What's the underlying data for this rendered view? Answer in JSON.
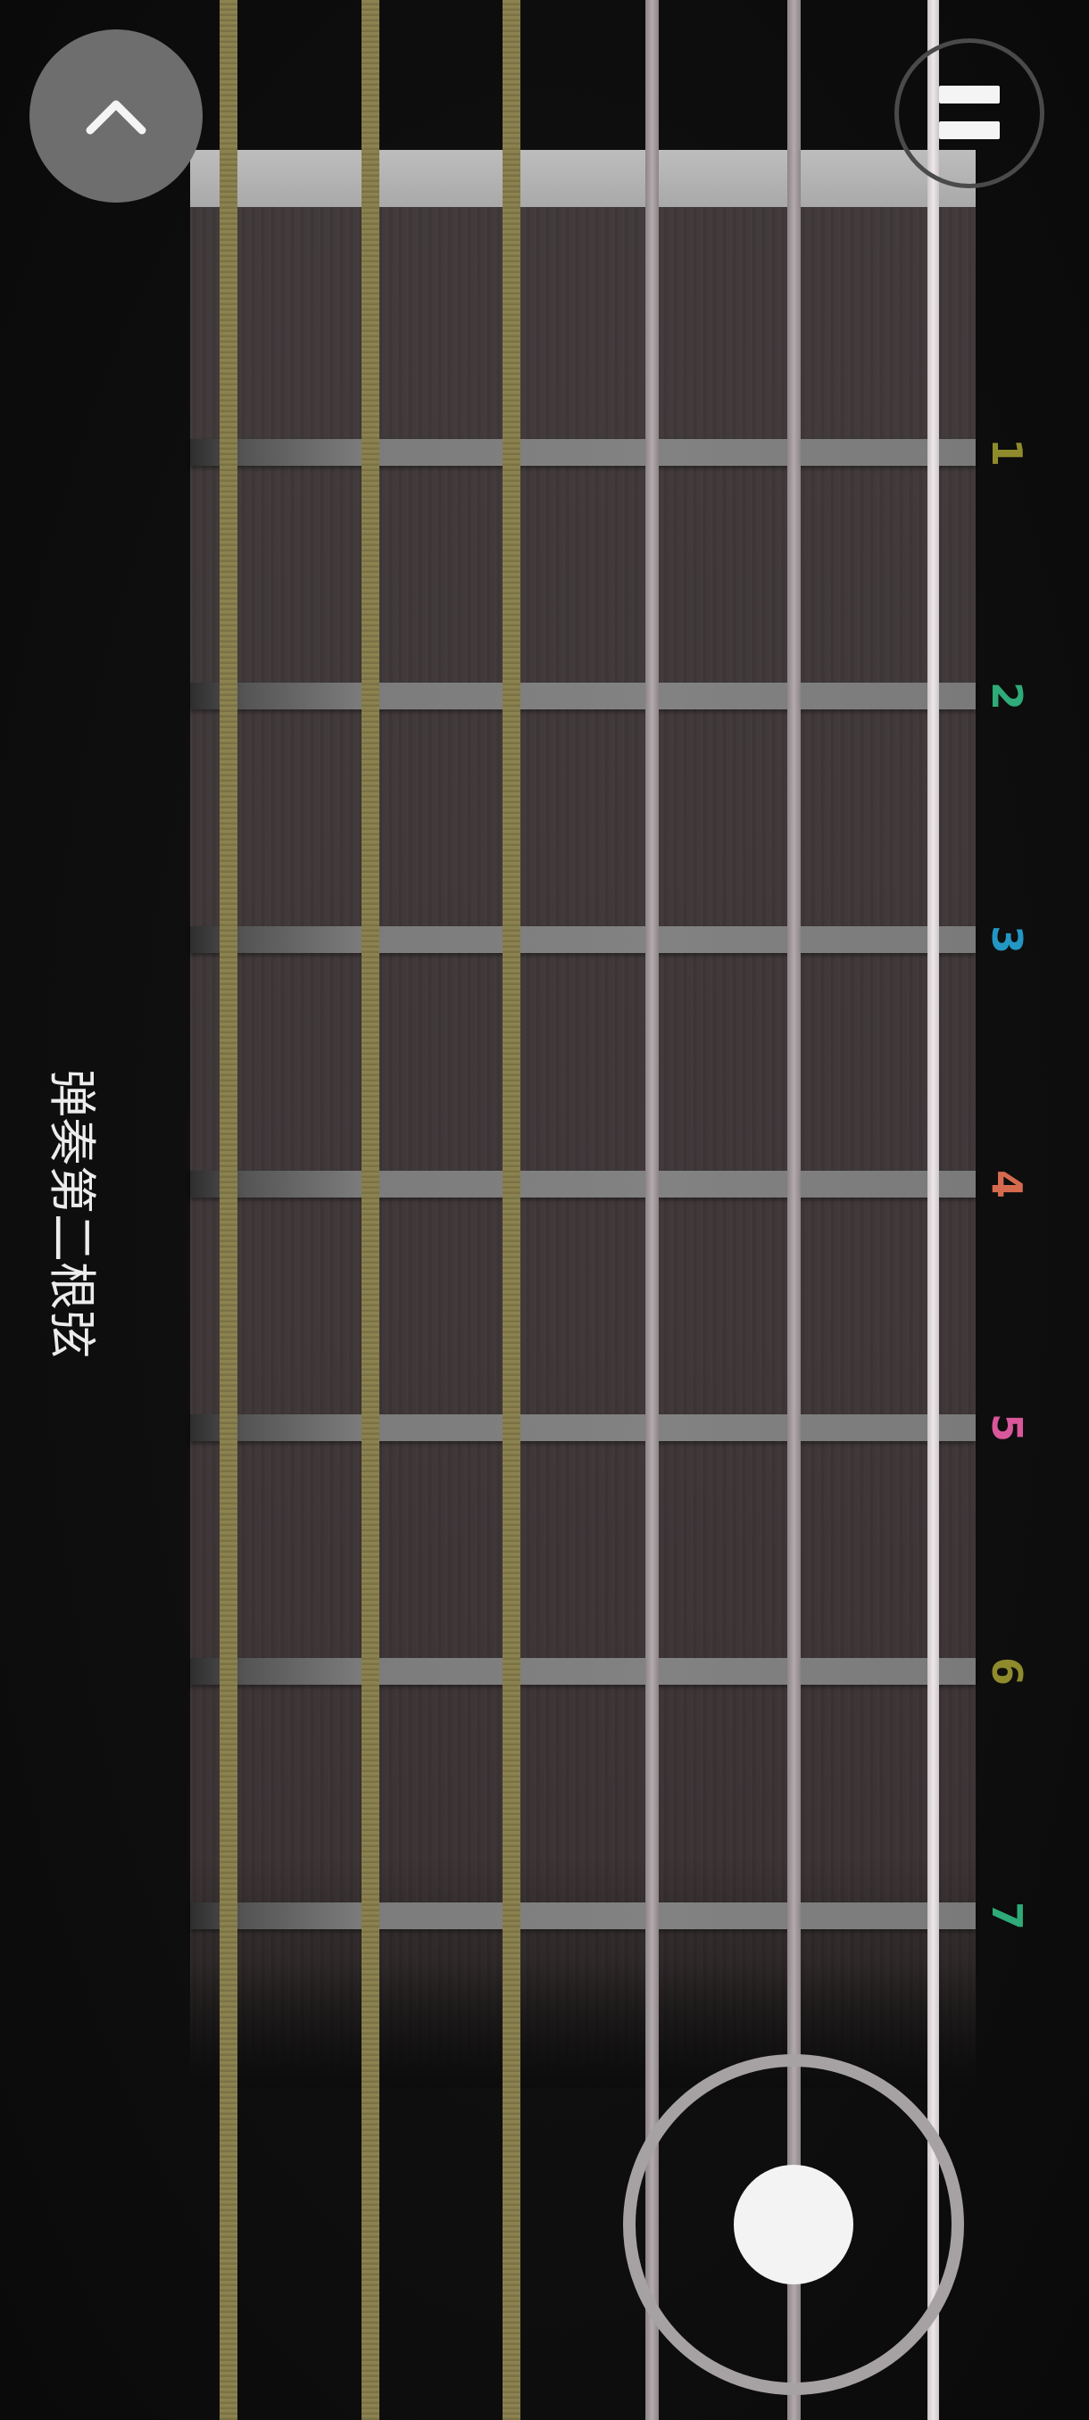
{
  "screen": {
    "instruction_text": "弹奏第二根弦"
  },
  "controls": {
    "back_icon": "chevron-up-icon",
    "pause_icon": "pause-icon",
    "strum_knob_icon": "joystick-knob"
  },
  "frets": [
    {
      "label": "1",
      "color": "#8f8b2c"
    },
    {
      "label": "2",
      "color": "#2eab78"
    },
    {
      "label": "3",
      "color": "#2397c4"
    },
    {
      "label": "4",
      "color": "#d66a4f"
    },
    {
      "label": "5",
      "color": "#d9579b"
    },
    {
      "label": "6",
      "color": "#8f8b2c"
    },
    {
      "label": "7",
      "color": "#2eab78"
    }
  ],
  "colors": {
    "background": "#0c0c0c",
    "wood": "#3e3637",
    "nut": "#b5b5b5",
    "wound_string": "#8b8250",
    "plain_string": "#a79ea2",
    "high_string": "#e6e0e2",
    "button_fill": "#6e6e6e",
    "joystick_ring": "#a6a2a3",
    "joystick_knob": "#f3f3f3"
  }
}
